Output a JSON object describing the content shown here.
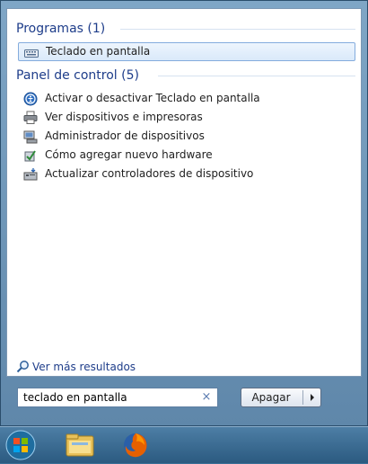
{
  "groups": {
    "programs": {
      "header": "Programas (1)"
    },
    "control_panel": {
      "header": "Panel de control (5)"
    }
  },
  "programs_items": [
    {
      "label": "Teclado en pantalla",
      "icon": "keyboard-icon"
    }
  ],
  "control_panel_items": [
    {
      "label": "Activar o desactivar Teclado en pantalla",
      "icon": "ease-of-access-icon"
    },
    {
      "label": "Ver dispositivos e impresoras",
      "icon": "printer-icon"
    },
    {
      "label": "Administrador de dispositivos",
      "icon": "device-manager-icon"
    },
    {
      "label": "Cómo agregar nuevo hardware",
      "icon": "add-hardware-icon"
    },
    {
      "label": "Actualizar controladores de dispositivo",
      "icon": "driver-update-icon"
    }
  ],
  "more_results": {
    "label": "Ver más resultados"
  },
  "search": {
    "value": "teclado en pantalla",
    "clear_glyph": "×"
  },
  "shutdown": {
    "label": "Apagar"
  },
  "taskbar": {
    "items": [
      "start-orb-icon",
      "windows-explorer-icon",
      "firefox-icon"
    ]
  },
  "colors": {
    "accent": "#1e3d8a",
    "selection_border": "#84acdd",
    "taskbar": "#2b5a80"
  }
}
